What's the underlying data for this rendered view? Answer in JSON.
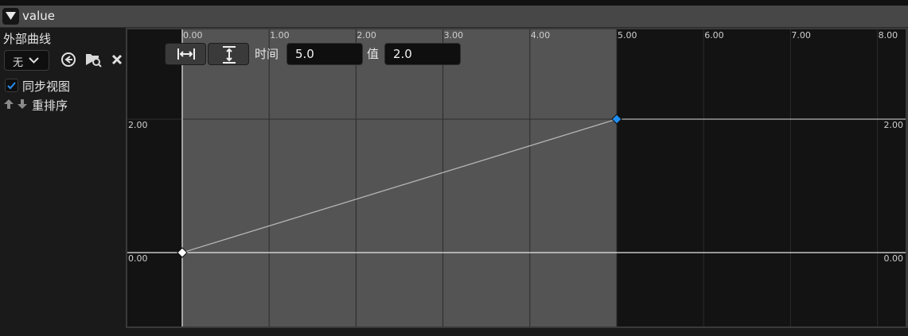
{
  "header": {
    "title": "value"
  },
  "sidebar": {
    "external_curve_label": "外部曲线",
    "curve_select_value": "无",
    "sync_view_label": "同步视图",
    "sync_view_checked": true,
    "reorder_label": "重排序"
  },
  "toolbar": {
    "time_label": "时间",
    "time_value": "5.0",
    "value_label": "值",
    "value_value": "2.0"
  },
  "graph": {
    "x_ticks": [
      "0.00",
      "1.00",
      "2.00",
      "3.00",
      "4.00",
      "5.00",
      "6.00",
      "7.00",
      "8.00"
    ],
    "y_left_ticks": [
      "2.00",
      "0.00"
    ],
    "y_right_ticks": [
      "2.00",
      "0.00"
    ],
    "keys": [
      {
        "time": 0.0,
        "value": 0.0,
        "selected": false
      },
      {
        "time": 5.0,
        "value": 2.0,
        "selected": true
      }
    ],
    "active_range": [
      0.0,
      5.0
    ],
    "colors": {
      "active_bg": "#545454",
      "inactive_bg": "#131313",
      "curve": "#b5b5b5",
      "selected_key": "#1f8ef1"
    }
  },
  "icons": {
    "collapse": "triangle-down-icon",
    "dropdown": "chevron-down-icon",
    "use_selected": "arrow-left-circle-icon",
    "browse": "folder-search-icon",
    "clear": "close-icon",
    "check": "checkmark-icon",
    "move_up": "arrow-up-icon",
    "move_down": "arrow-down-icon",
    "fit_horizontal": "fit-horizontal-icon",
    "fit_vertical": "fit-vertical-icon"
  }
}
